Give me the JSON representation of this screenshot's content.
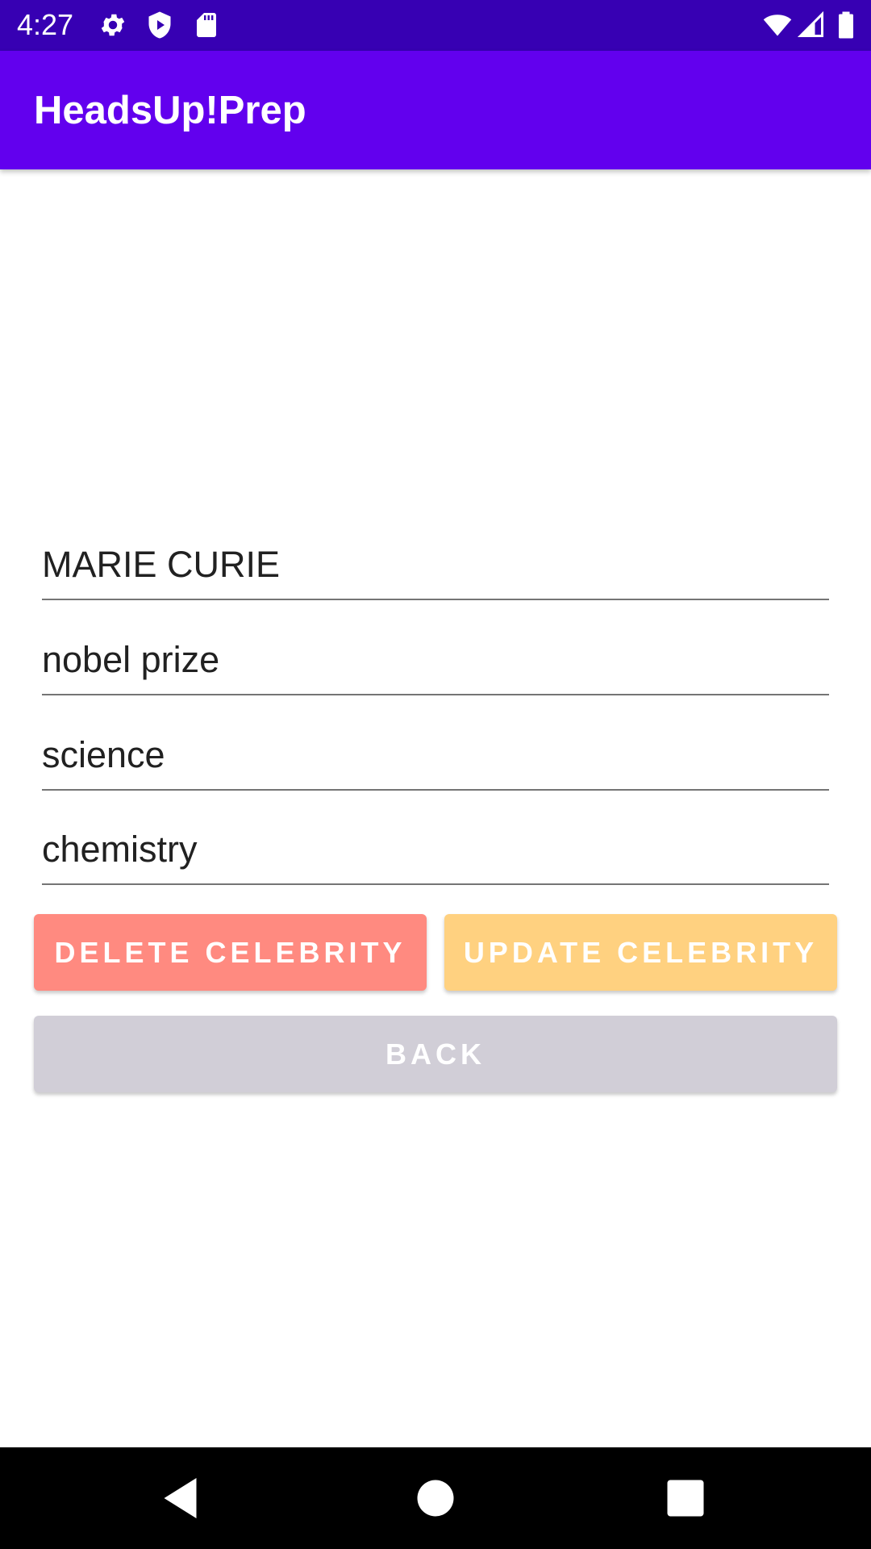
{
  "status_bar": {
    "time": "4:27",
    "icons": [
      "gear-icon",
      "shield-play-icon",
      "sd-card-icon",
      "wifi-icon",
      "signal-icon",
      "battery-icon"
    ]
  },
  "app_bar": {
    "title": "HeadsUp!Prep"
  },
  "form": {
    "name": "MARIE CURIE",
    "taboo_1": "nobel prize",
    "taboo_2": "science",
    "taboo_3": "chemistry"
  },
  "buttons": {
    "delete_label": "DELETE CELEBRITY",
    "update_label": "UPDATE CELEBRITY",
    "back_label": "BACK"
  },
  "nav_bar": {
    "icons": [
      "back-triangle-icon",
      "home-circle-icon",
      "recents-square-icon"
    ]
  },
  "colors": {
    "status_bar": "#3700b3",
    "app_bar": "#6200ee",
    "delete": "#ff8a80",
    "update": "#ffd180",
    "back": "#d1ced7"
  }
}
